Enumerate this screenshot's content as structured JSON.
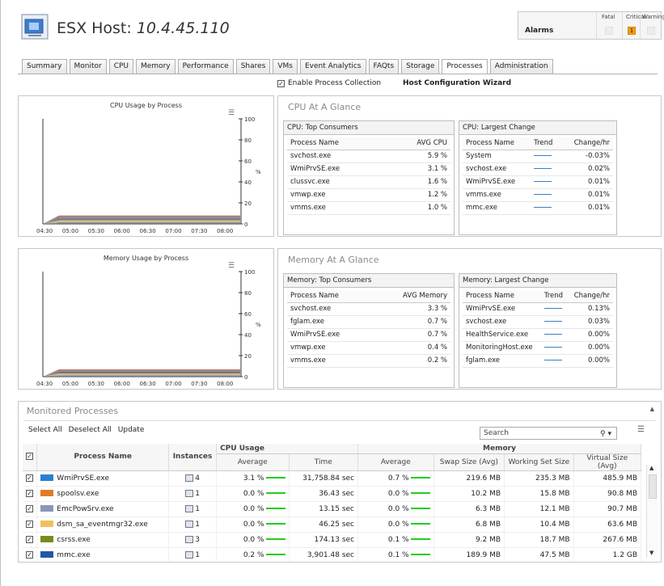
{
  "header": {
    "title_prefix": "ESX Host: ",
    "title_host": "10.4.45.110",
    "icon": "server-icon"
  },
  "alarms": {
    "label": "Alarms",
    "col_fatal": "Fatal",
    "col_critical": "Critical",
    "col_warning": "Warning",
    "critical_count": "1",
    "critical_color": "#f39c12"
  },
  "tabs": [
    {
      "label": "Summary"
    },
    {
      "label": "Monitor"
    },
    {
      "label": "CPU"
    },
    {
      "label": "Memory"
    },
    {
      "label": "Performance"
    },
    {
      "label": "Shares"
    },
    {
      "label": "VMs"
    },
    {
      "label": "Event Analytics"
    },
    {
      "label": "FAQts"
    },
    {
      "label": "Storage"
    },
    {
      "label": "Processes",
      "active": true
    },
    {
      "label": "Administration"
    }
  ],
  "options": {
    "enable_collection": "Enable Process Collection",
    "wizard": "Host Configuration Wizard"
  },
  "chart_data": [
    {
      "type": "area",
      "title": "CPU Usage by Process",
      "x": [
        "04:30",
        "05:00",
        "05:30",
        "06:00",
        "06:30",
        "07:00",
        "07:30",
        "08:00"
      ],
      "ylabel": "%",
      "yticks": [
        "0",
        "20",
        "40",
        "60",
        "80",
        "100"
      ],
      "ylim": [
        0,
        100
      ],
      "stacked_total_approx": 8,
      "legend_icon": "legend-menu-icon"
    },
    {
      "type": "area",
      "title": "Memory Usage by Process",
      "x": [
        "04:30",
        "05:00",
        "05:30",
        "06:00",
        "06:30",
        "07:00",
        "07:30",
        "08:00"
      ],
      "ylabel": "%",
      "yticks": [
        "0",
        "20",
        "40",
        "60",
        "80",
        "100"
      ],
      "ylim": [
        0,
        100
      ],
      "stacked_total_approx": 7,
      "legend_icon": "legend-menu-icon"
    }
  ],
  "cpu_glance": {
    "title": "CPU At A Glance",
    "top": {
      "title": "CPU: Top Consumers",
      "col_name": "Process Name",
      "col_val": "AVG CPU",
      "rows": [
        {
          "name": "svchost.exe",
          "value": "5.9 %"
        },
        {
          "name": "WmiPrvSE.exe",
          "value": "3.1 %"
        },
        {
          "name": "clussvc.exe",
          "value": "1.6 %"
        },
        {
          "name": "vmwp.exe",
          "value": "1.2 %"
        },
        {
          "name": "vmms.exe",
          "value": "1.0 %"
        }
      ]
    },
    "change": {
      "title": "CPU: Largest Change",
      "col_name": "Process Name",
      "col_trend": "Trend",
      "col_val": "Change/hr",
      "rows": [
        {
          "name": "System",
          "value": "-0.03%"
        },
        {
          "name": "svchost.exe",
          "value": "0.02%"
        },
        {
          "name": "WmiPrvSE.exe",
          "value": "0.01%"
        },
        {
          "name": "vmms.exe",
          "value": "0.01%"
        },
        {
          "name": "mmc.exe",
          "value": "0.01%"
        }
      ]
    }
  },
  "mem_glance": {
    "title": "Memory At A Glance",
    "top": {
      "title": "Memory: Top Consumers",
      "col_name": "Process Name",
      "col_val": "AVG Memory",
      "rows": [
        {
          "name": "svchost.exe",
          "value": "3.3 %"
        },
        {
          "name": "fglam.exe",
          "value": "0.7 %"
        },
        {
          "name": "WmiPrvSE.exe",
          "value": "0.7 %"
        },
        {
          "name": "vmwp.exe",
          "value": "0.4 %"
        },
        {
          "name": "vmms.exe",
          "value": "0.2 %"
        }
      ]
    },
    "change": {
      "title": "Memory: Largest Change",
      "col_name": "Process Name",
      "col_trend": "Trend",
      "col_val": "Change/hr",
      "rows": [
        {
          "name": "WmiPrvSE.exe",
          "value": "0.13%"
        },
        {
          "name": "svchost.exe",
          "value": "0.03%"
        },
        {
          "name": "HealthService.exe",
          "value": "0.00%"
        },
        {
          "name": "MonitoringHost.exe",
          "value": "0.00%"
        },
        {
          "name": "fglam.exe",
          "value": "0.00%"
        }
      ]
    }
  },
  "monitored": {
    "title": "Monitored Processes",
    "select_all": "Select All",
    "deselect_all": "Deselect All",
    "update": "Update",
    "search_placeholder": "Search",
    "headers": {
      "process_name": "Process Name",
      "instances": "Instances",
      "cpu_usage": "CPU Usage",
      "memory": "Memory",
      "cpu_avg": "Average",
      "cpu_time": "Time",
      "mem_avg": "Average",
      "swap": "Swap Size (Avg)",
      "working": "Working Set Size",
      "virtual": "Virtual Size (Avg)"
    },
    "rows": [
      {
        "name": "WmiPrvSE.exe",
        "color": "#2a7fd4",
        "instances": "4",
        "cpu_avg": "3.1 %",
        "cpu_time": "31,758.84 sec",
        "mem_avg": "0.7 %",
        "swap": "219.6 MB",
        "working": "235.3 MB",
        "virtual": "485.9 MB"
      },
      {
        "name": "spoolsv.exe",
        "color": "#e07b2a",
        "instances": "1",
        "cpu_avg": "0.0 %",
        "cpu_time": "36.43 sec",
        "mem_avg": "0.0 %",
        "swap": "10.2 MB",
        "working": "15.8 MB",
        "virtual": "90.8 MB"
      },
      {
        "name": "EmcPowSrv.exe",
        "color": "#8a96b8",
        "instances": "1",
        "cpu_avg": "0.0 %",
        "cpu_time": "13.15 sec",
        "mem_avg": "0.0 %",
        "swap": "6.3 MB",
        "working": "12.1 MB",
        "virtual": "90.7 MB"
      },
      {
        "name": "dsm_sa_eventmgr32.exe",
        "color": "#f0c060",
        "instances": "1",
        "cpu_avg": "0.0 %",
        "cpu_time": "46.25 sec",
        "mem_avg": "0.0 %",
        "swap": "6.8 MB",
        "working": "10.4 MB",
        "virtual": "63.6 MB"
      },
      {
        "name": "csrss.exe",
        "color": "#7a8a1a",
        "instances": "3",
        "cpu_avg": "0.0 %",
        "cpu_time": "174.13 sec",
        "mem_avg": "0.1 %",
        "swap": "9.2 MB",
        "working": "18.7 MB",
        "virtual": "267.6 MB"
      },
      {
        "name": "mmc.exe",
        "color": "#2456a8",
        "instances": "1",
        "cpu_avg": "0.2 %",
        "cpu_time": "3,901.48 sec",
        "mem_avg": "0.1 %",
        "swap": "189.9 MB",
        "working": "47.5 MB",
        "virtual": "1.2 GB"
      }
    ]
  }
}
